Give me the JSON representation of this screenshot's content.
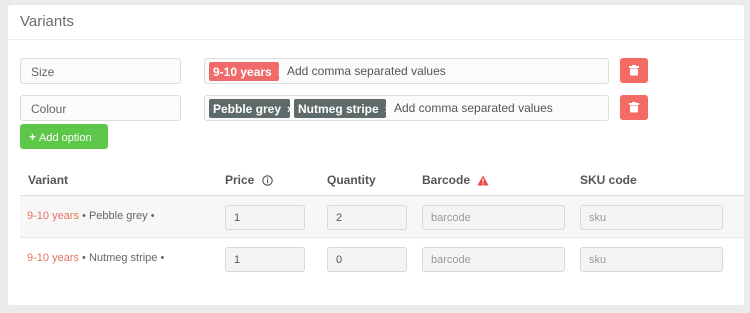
{
  "card": {
    "title": "Variants"
  },
  "options": [
    {
      "name": "Size",
      "values": [
        "9-10 years"
      ],
      "placeholder": "Add comma separated values"
    },
    {
      "name": "Colour",
      "values": [
        "Pebble grey",
        "Nutmeg stripe"
      ],
      "placeholder": "Add comma separated values"
    }
  ],
  "tag_remove_glyph": "×",
  "add_option_label": "Add option",
  "add_option_glyph": "+",
  "table": {
    "headers": {
      "variant": "Variant",
      "price": "Price",
      "quantity": "Quantity",
      "barcode": "Barcode",
      "sku": "SKU code"
    },
    "rows": [
      {
        "size": "9-10 years",
        "rest": " • Pebble grey •",
        "price": "1",
        "quantity": "2",
        "barcode_placeholder": "barcode",
        "sku_placeholder": "sku"
      },
      {
        "size": "9-10 years",
        "rest": " • Nutmeg stripe •",
        "price": "1",
        "quantity": "0",
        "barcode_placeholder": "barcode",
        "sku_placeholder": "sku"
      }
    ]
  },
  "colors": {
    "tag_size": "#f06a6a",
    "tag_colour": "#5f6b6b",
    "delete": "#f36b63",
    "add": "#5dc74a",
    "variant_size_text": "#e07560",
    "warning": "#e84b3c"
  },
  "icons": {
    "price_info": "info-circle-icon",
    "barcode_warning": "warning-triangle-icon",
    "delete": "trash-icon",
    "add": "plus-icon",
    "tag_remove": "close-icon"
  }
}
